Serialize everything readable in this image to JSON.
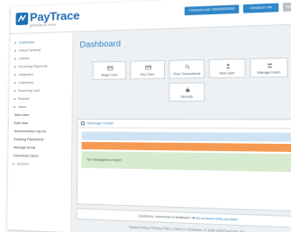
{
  "header": {
    "logo_name": "PayTrace",
    "logo_tagline": "gateway to more",
    "support_button": "Checkout Link: 000000000000",
    "account_button": "Checkout Link",
    "logout_button": "Sign Out"
  },
  "sidebar": {
    "items": [
      {
        "label": "Dashboard"
      },
      {
        "label": "Virtual Terminal"
      },
      {
        "label": "Checks"
      },
      {
        "label": "Recurring Payments"
      },
      {
        "label": "Integration"
      },
      {
        "label": "Customers"
      },
      {
        "label": "Recurring Card"
      },
      {
        "label": "Reports"
      },
      {
        "label": "Users"
      },
      {
        "label": "New User"
      },
      {
        "label": "Edit User"
      },
      {
        "label": "Unsuccessful Log Ins"
      },
      {
        "label": "Expiring Passwords"
      },
      {
        "label": "Manage Email"
      },
      {
        "label": "Download Users"
      },
      {
        "label": "Account"
      }
    ]
  },
  "main": {
    "title": "Dashboard",
    "tiles": [
      {
        "label": "Swipe Card",
        "icon": "card-icon"
      },
      {
        "label": "Key Card",
        "icon": "card-icon"
      },
      {
        "label": "View Transactions",
        "icon": "search-icon"
      },
      {
        "label": "New User",
        "icon": "user-icon"
      },
      {
        "label": "Manage Users",
        "icon": "users-icon"
      },
      {
        "label": "Security",
        "icon": "lock-icon"
      }
    ],
    "message_center": {
      "title": "Message Center",
      "empty_text": "No messages to report."
    }
  },
  "feedback": {
    "text": "Questions, comments or feedback?",
    "link": "Let us know what you think"
  },
  "footer": {
    "text": "Support Policy | Privacy Policy | Terms & Conditions | © 2009-2018 PayTrace, Inc."
  },
  "colors": {
    "accent": "#2f86c8",
    "info_bar": "#cfe3f4",
    "warning_bar": "#f59a52",
    "success_bar": "#d7ebd0"
  }
}
